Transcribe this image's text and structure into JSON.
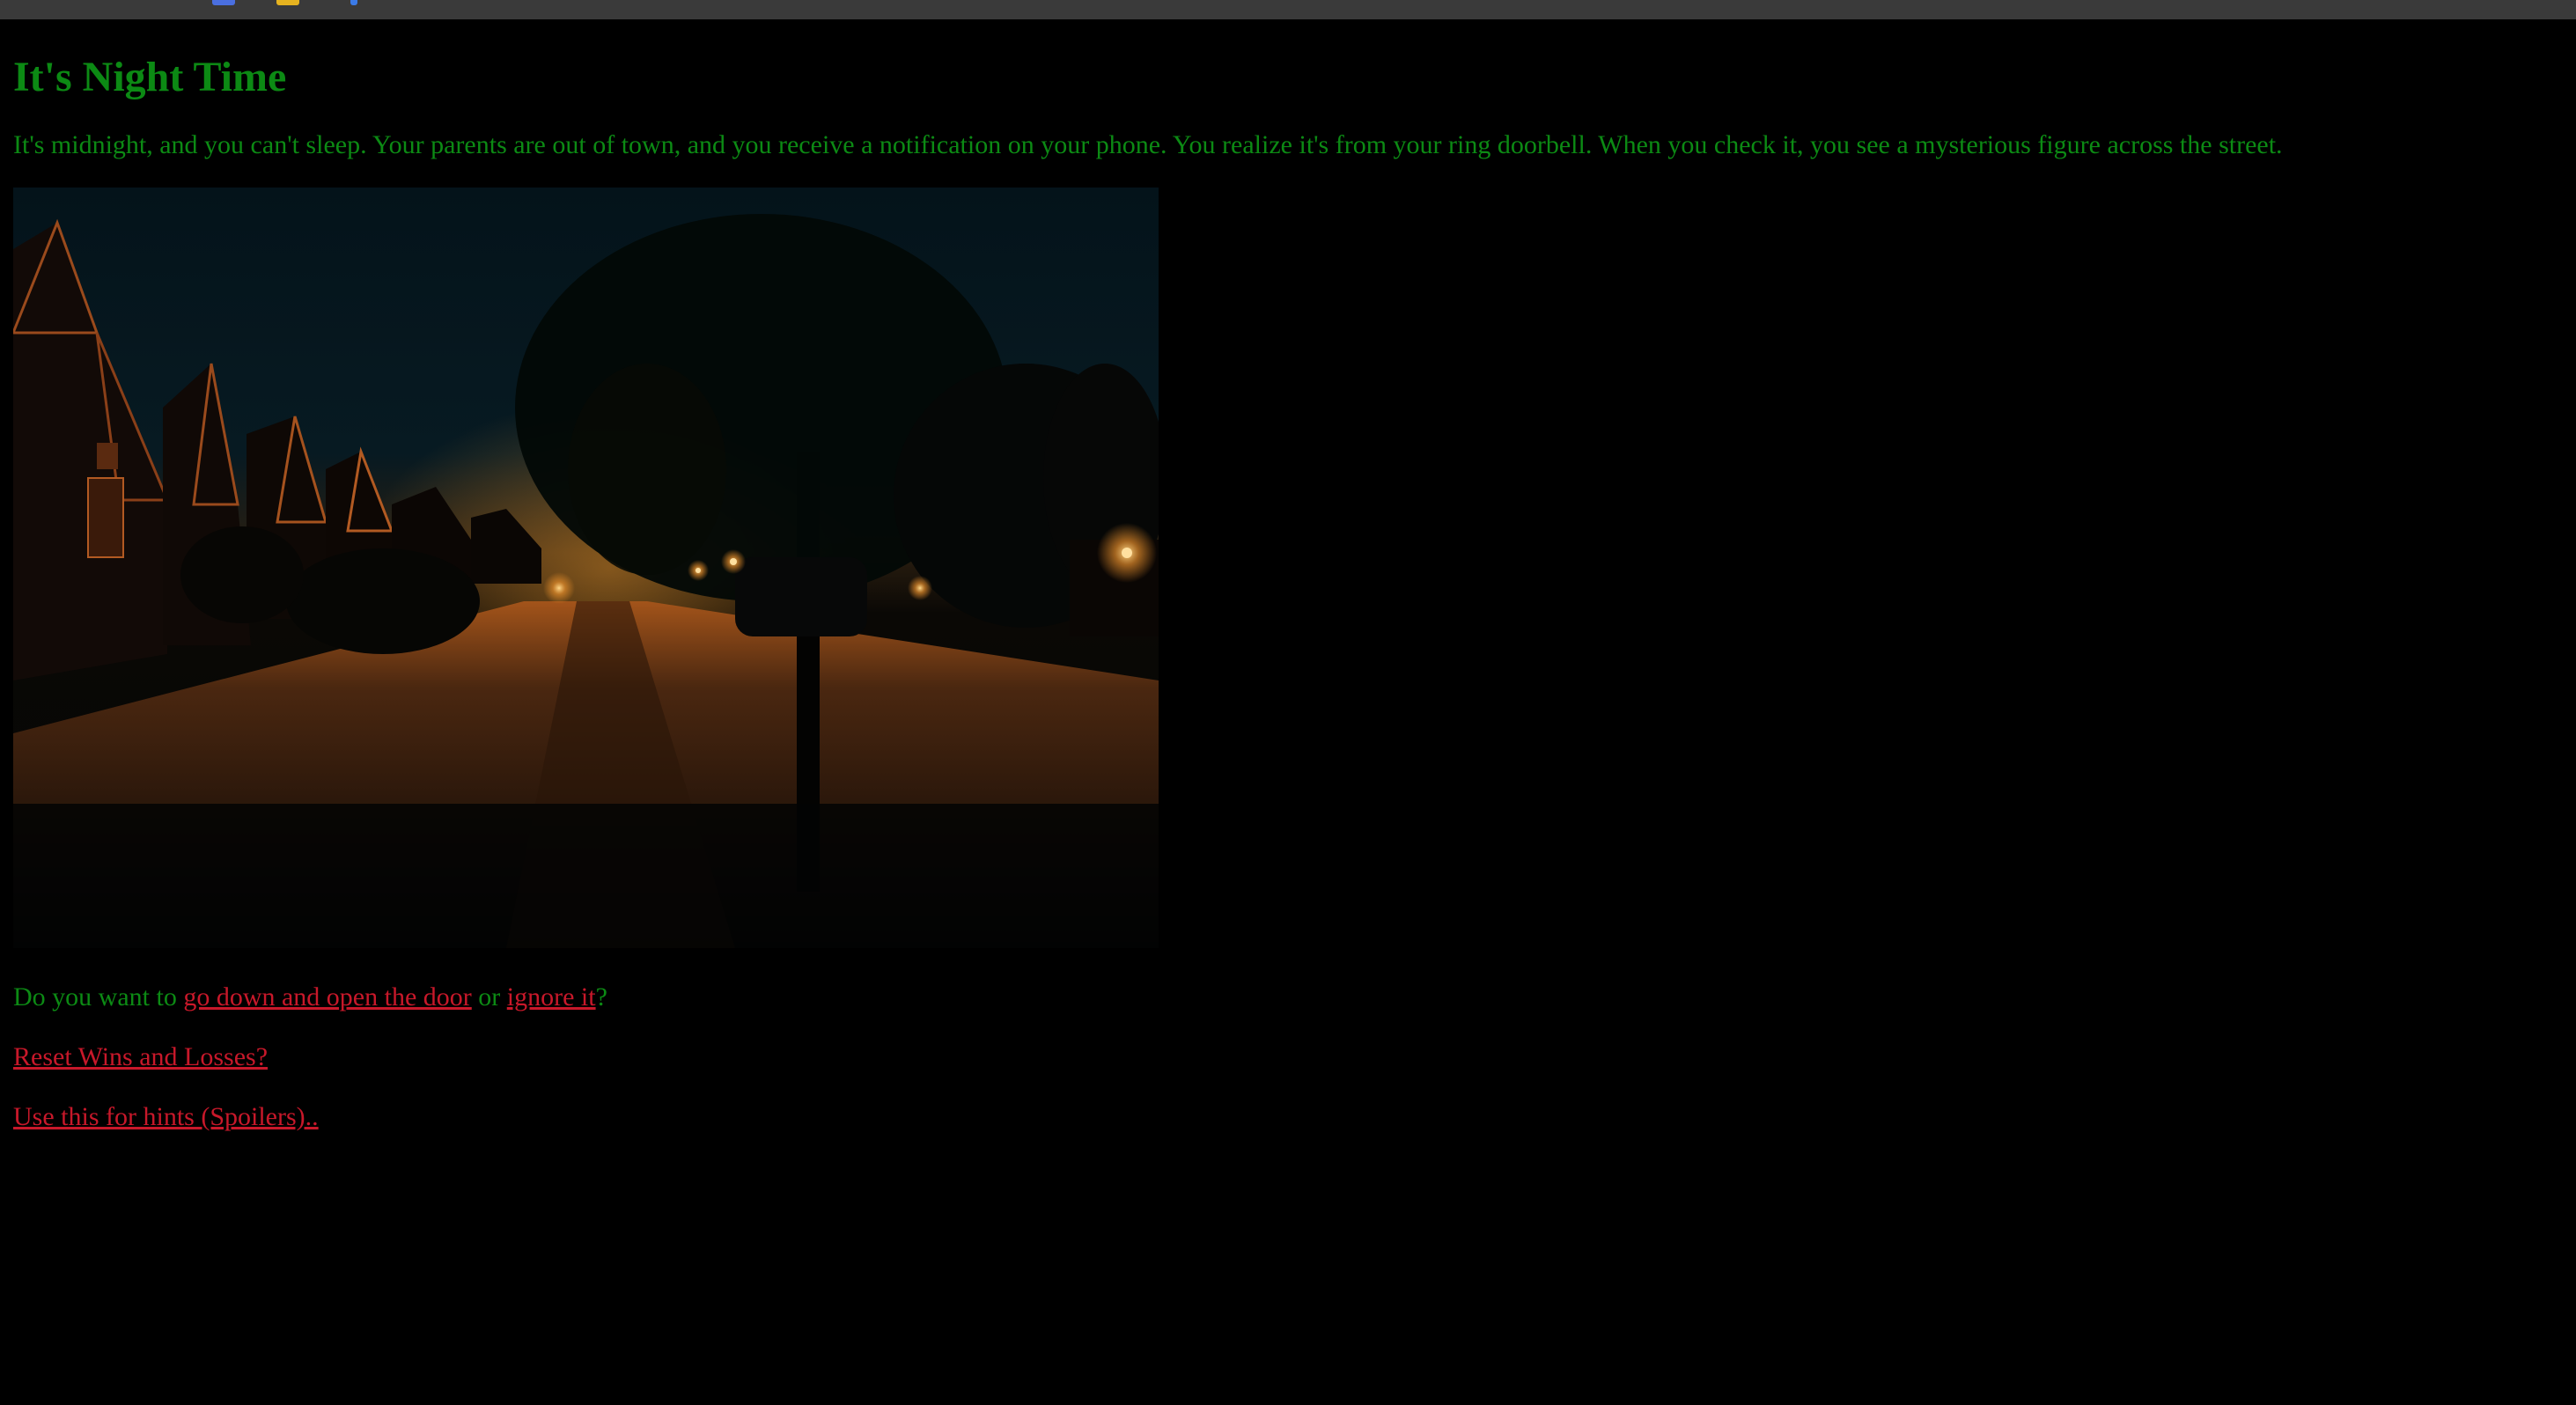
{
  "page": {
    "title": "It's Night Time",
    "intro": "It's midnight, and you can't sleep. Your parents are out of town, and you receive a notification on your phone. You realize it's from your ring doorbell. When you check it, you see a mysterious figure across the street."
  },
  "colors": {
    "background": "#000000",
    "text": "#0c8a14",
    "link": "#c8182a"
  },
  "choice": {
    "prefix": "Do you want to ",
    "option_open_door": "go down and open the door",
    "middle": " or ",
    "option_ignore": "ignore it",
    "suffix": "?"
  },
  "links": {
    "reset": "Reset Wins and Losses?",
    "hints": "Use this for hints (Spoilers).."
  }
}
